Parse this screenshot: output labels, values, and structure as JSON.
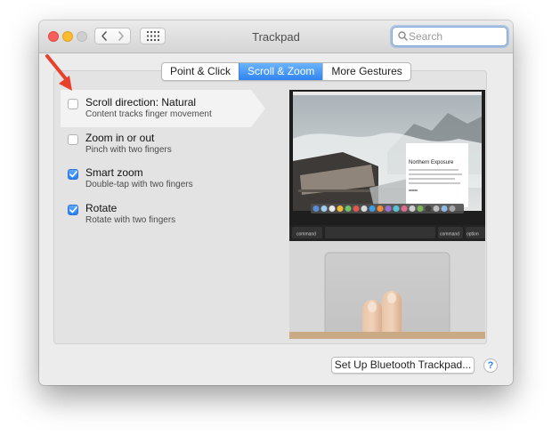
{
  "window": {
    "title": "Trackpad",
    "search": {
      "placeholder": "Search",
      "value": ""
    }
  },
  "icons": {
    "close": "close-traffic-light",
    "minimize": "minimize-traffic-light",
    "zoom": "zoom-traffic-light",
    "back": "chevron-left-icon",
    "forward": "chevron-right-icon",
    "show_all": "grid-icon",
    "search": "magnifying-glass-icon",
    "help": "question-mark-icon",
    "annotation": "red-arrow-icon"
  },
  "tabs": [
    {
      "label": "Point & Click",
      "selected": false
    },
    {
      "label": "Scroll & Zoom",
      "selected": true
    },
    {
      "label": "More Gestures",
      "selected": false
    }
  ],
  "options": [
    {
      "label": "Scroll direction: Natural",
      "description": "Content tracks finger movement",
      "checked": false,
      "highlighted": true
    },
    {
      "label": "Zoom in or out",
      "description": "Pinch with two fingers",
      "checked": false
    },
    {
      "label": "Smart zoom",
      "description": "Double-tap with two fingers",
      "checked": true
    },
    {
      "label": "Rotate",
      "description": "Rotate with two fingers",
      "checked": true
    }
  ],
  "preview": {
    "window_title": "Northern Exposure",
    "keys": [
      "command",
      "command",
      "option"
    ]
  },
  "footer": {
    "bluetooth_button": "Set Up Bluetooth Trackpad...",
    "help": "?"
  },
  "colors": {
    "accent": "#3b8df3",
    "annotation": "#e8412b",
    "traffic_close": "#fc5f57",
    "traffic_minimize": "#fdbc2e"
  }
}
